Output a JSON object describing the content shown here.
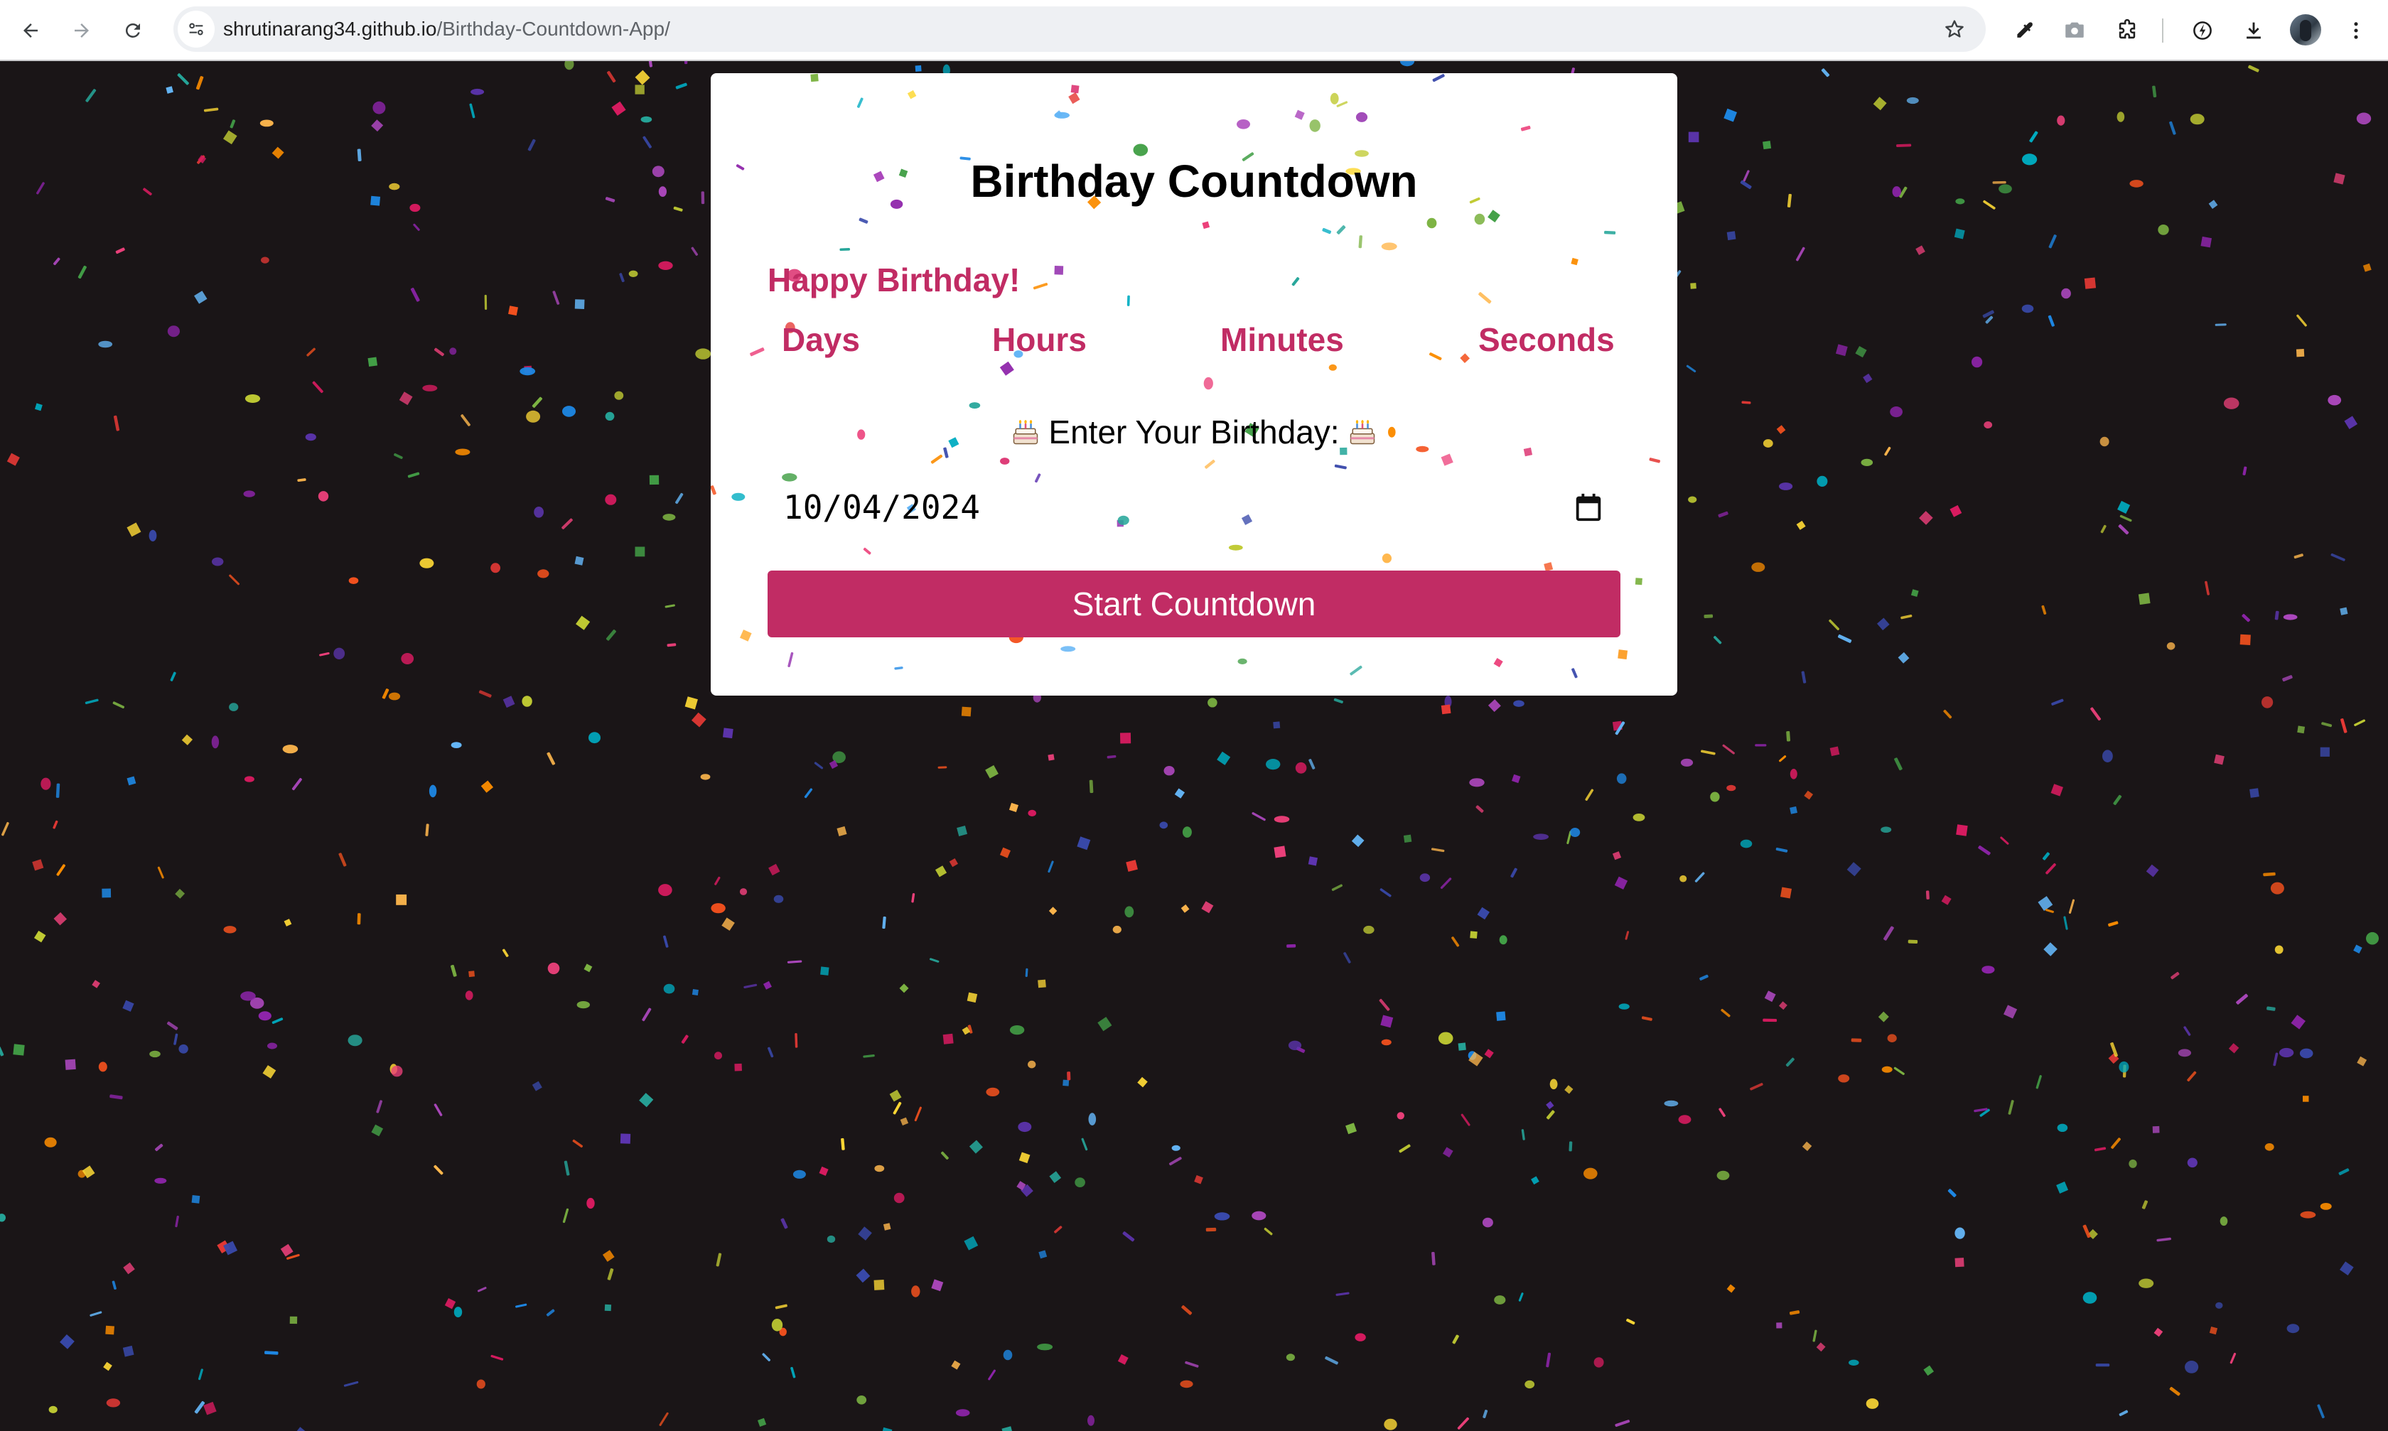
{
  "browser": {
    "url_host": "shrutinarang34.github.io",
    "url_path": "/Birthday-Countdown-App/",
    "icons": {
      "back": "back-arrow-icon",
      "forward": "forward-arrow-icon",
      "reload": "reload-icon",
      "site_info": "site-settings-icon",
      "bookmark": "star-icon",
      "eyedropper": "eyedropper-icon",
      "camera": "camera-icon",
      "extensions": "puzzle-icon",
      "performance": "speed-icon",
      "downloads": "download-icon",
      "menu": "kebab-menu-icon"
    }
  },
  "app": {
    "title": "Birthday Countdown",
    "greeting": "Happy Birthday!",
    "units": {
      "days": "Days",
      "hours": "Hours",
      "minutes": "Minutes",
      "seconds": "Seconds"
    },
    "prompt": "Enter Your Birthday:",
    "birthday_value": "10/04/2024",
    "start_label": "Start Countdown",
    "colors": {
      "accent": "#c12c64",
      "background": "#1a1517",
      "card": "#ffffff"
    },
    "confetti_colors": [
      "#e53935",
      "#8e24aa",
      "#3949ab",
      "#43a047",
      "#fdd835",
      "#fb8c00",
      "#d81b60",
      "#00acc1",
      "#7cb342",
      "#5e35b1",
      "#f4511e",
      "#1e88e5",
      "#c0ca33",
      "#26a69a",
      "#ab47bc",
      "#ffb74d",
      "#64b5f6",
      "#ec407a"
    ]
  }
}
